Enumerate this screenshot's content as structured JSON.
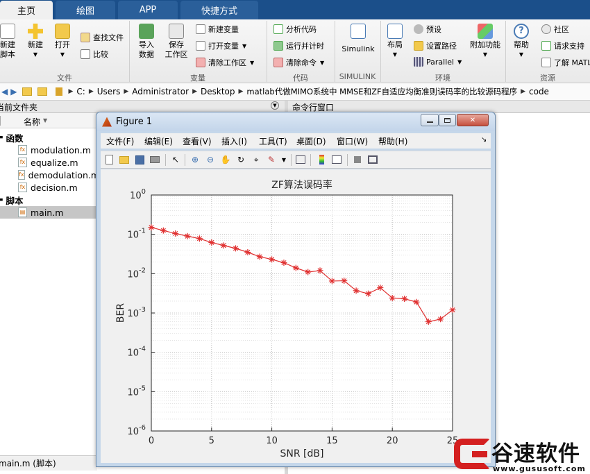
{
  "tabs": [
    "主页",
    "绘图",
    "APP",
    "快捷方式"
  ],
  "ribbon": {
    "file_group": {
      "label": "文件",
      "new_script": "新建\n脚本",
      "new": "新建",
      "open": "打开",
      "find_files": "查找文件",
      "compare": "比较"
    },
    "variable_group": {
      "label": "变量",
      "import_data": "导入\n数据",
      "save_workspace": "保存\n工作区",
      "new_variable": "新建变量",
      "open_variable": "打开变量",
      "clear_workspace": "清除工作区"
    },
    "code_group": {
      "label": "代码",
      "analyze_code": "分析代码",
      "run_and_time": "运行并计时",
      "clear_commands": "清除命令"
    },
    "simulink_group": {
      "label": "SIMULINK",
      "simulink": "Simulink"
    },
    "env_group": {
      "label": "环境",
      "layout": "布局",
      "preferences": "预设",
      "set_path": "设置路径",
      "parallel": "Parallel",
      "addons": "附加功能"
    },
    "resources_group": {
      "label": "资源",
      "help": "帮助",
      "community": "社区",
      "request_support": "请求支持",
      "learn_matlab": "了解 MATL"
    }
  },
  "address": {
    "segments": [
      "C:",
      "Users",
      "Administrator",
      "Desktop",
      "matlab代做MIMO系统中 MMSE和ZF自适应均衡准则误码率的比较源码程序",
      "code"
    ]
  },
  "current_folder": {
    "title": "当前文件夹",
    "column_name": "名称",
    "command_window_title": "命令行窗口",
    "sections": [
      {
        "label": "函数",
        "files": [
          "modulation.m",
          "equalize.m",
          "demodulation.m",
          "decision.m"
        ]
      },
      {
        "label": "脚本",
        "files": [
          "main.m"
        ]
      }
    ],
    "status": "main.m  (脚本)"
  },
  "figure": {
    "title": "Figure 1",
    "menu": [
      "文件(F)",
      "编辑(E)",
      "查看(V)",
      "插入(I)",
      "工具(T)",
      "桌面(D)",
      "窗口(W)",
      "帮助(H)"
    ]
  },
  "chart_data": {
    "type": "line",
    "title": "ZF算法误码率",
    "xlabel": "SNR [dB]",
    "ylabel": "BER",
    "x_scale": "linear",
    "y_scale": "log",
    "xlim": [
      0,
      25
    ],
    "ylim": [
      1e-06,
      1
    ],
    "x_ticks": [
      "0",
      "5",
      "10",
      "15",
      "20",
      "25"
    ],
    "y_ticks": [
      "10^0",
      "10^-1",
      "10^-2",
      "10^-3",
      "10^-4",
      "10^-5",
      "10^-6"
    ],
    "grid": true,
    "series": [
      {
        "color": "#e03030",
        "marker": "*",
        "x": [
          0,
          1,
          2,
          3,
          4,
          5,
          6,
          7,
          8,
          9,
          10,
          11,
          12,
          13,
          14,
          15,
          16,
          17,
          18,
          19,
          20,
          21,
          22,
          23,
          24,
          25
        ],
        "values": [
          0.15,
          0.125,
          0.105,
          0.09,
          0.078,
          0.062,
          0.052,
          0.044,
          0.035,
          0.027,
          0.023,
          0.019,
          0.014,
          0.011,
          0.012,
          0.0065,
          0.0066,
          0.0037,
          0.0031,
          0.0044,
          0.0024,
          0.0023,
          0.0019,
          0.0006,
          0.0007,
          0.0012
        ]
      }
    ]
  },
  "watermark": {
    "brand": "谷速软件",
    "url": "www.gususoft.com"
  },
  "colors": {
    "tab_bar": "#1b4f8a",
    "series_red": "#e03030",
    "watermark_red": "#d42020"
  }
}
